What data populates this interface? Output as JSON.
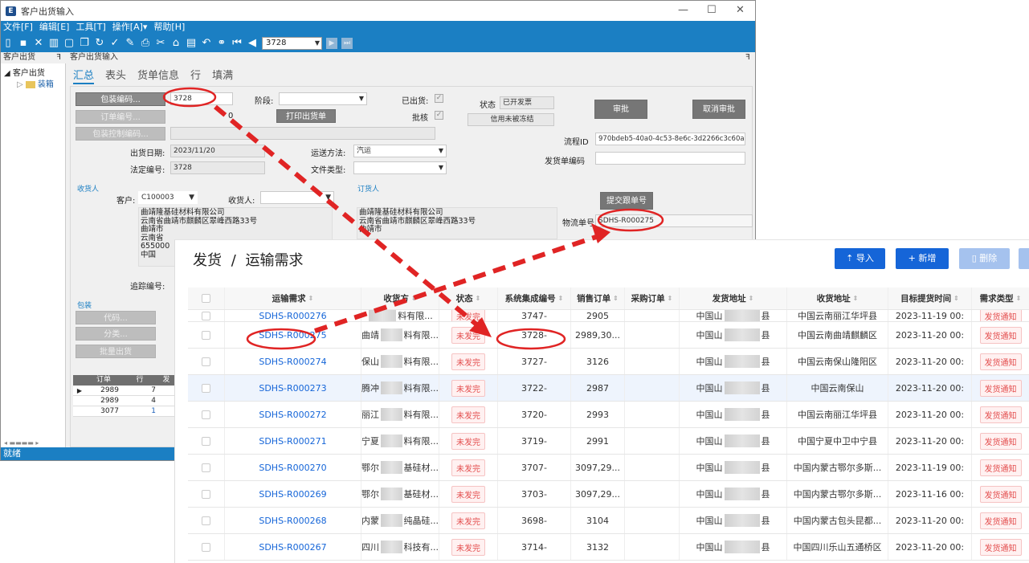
{
  "desktop": {
    "window_title": "客户出货输入",
    "menu": [
      "文件[F]",
      "编辑[E]",
      "工具[T]",
      "操作[A]▾",
      "帮助[H]"
    ],
    "toolbar_record": "3728",
    "left_pane_title": "客户出货",
    "left_pane_pin": "ꟻ",
    "right_pane_title": "客户出货输入",
    "tree": {
      "root": "客户出货",
      "child": "装箱"
    },
    "tabs": [
      "汇总",
      "表头",
      "货单信息",
      "行",
      "填满"
    ],
    "form": {
      "btn_package_code": "包装编码...",
      "package_code_value": "3728",
      "btn_order_no": "订单编号...",
      "order_no_tail": "0",
      "btn_package_ctrl": "包装控制编码...",
      "stage_label": "阶段:",
      "btn_print": "打印出货单",
      "shipped_label": "已出货:",
      "approved_label": "批核",
      "status_label": "状态",
      "status_value": "已开发票",
      "credit_value": "信用未被冻结",
      "btn_approve": "审批",
      "btn_cancel_approve": "取消审批",
      "ship_date_label": "出货日期:",
      "ship_date_value": "2023/11/20",
      "transport_label": "运送方法:",
      "transport_value": "汽运",
      "legal_no_label": "法定编号:",
      "legal_no_value": "3728",
      "file_type_label": "文件类型:",
      "flow_id_label": "流程ID",
      "flow_id_value": "970bdeb5-40a0-4c53-8e6c-3d2266c3c60a",
      "ship_order_code_label": "发货单编码",
      "consignee_section": "收货人",
      "customer_label": "客户:",
      "customer_value": "C100003",
      "receiver_label": "收货人:",
      "orderer_section": "订货人",
      "btn_submit_tracking": "提交跟单号",
      "logistics_label": "物流单号",
      "logistics_value": "SDHS-R000275",
      "consignee_address": [
        "曲靖隆基硅材料有限公司",
        "云南省曲靖市麒麟区翠峰西路33号",
        "曲靖市",
        "云南省",
        "655000",
        "中国"
      ],
      "orderer_address": [
        "曲靖隆基硅材料有限公司",
        "云南省曲靖市麒麟区翠峰西路33号",
        "曲靖市"
      ],
      "tracking_label": "追踪编号:",
      "pack_section": "包装",
      "btn_code": "代码...",
      "btn_category": "分类...",
      "btn_batch_ship": "批量出货"
    },
    "mini_grid": {
      "headers": [
        "订单",
        "行",
        "发"
      ],
      "rows": [
        [
          "2989",
          "7"
        ],
        [
          "2989",
          "4"
        ],
        [
          "3077",
          "1"
        ]
      ]
    },
    "status_bar": "就绪"
  },
  "web": {
    "breadcrumb_parent": "发货",
    "breadcrumb_sep": "/",
    "breadcrumb_current": "运输需求",
    "btn_import": "⇡ 导入",
    "btn_new": "+ 新增",
    "btn_delete": "删除",
    "columns": [
      "运输需求",
      "收货方",
      "状态",
      "系统集成编号",
      "销售订单",
      "采购订单",
      "发货地址",
      "收货地址",
      "目标提货时间",
      "需求类型"
    ],
    "rows": [
      {
        "id": "SDHS-R000276",
        "consignee": "料有限...",
        "status": "未发完",
        "sys_no": "3747-",
        "so": "2905",
        "po": "",
        "from": "中国山",
        "from2": "县",
        "to": "中国云南丽江华坪县",
        "time": "2023-11-19 00:",
        "type": "发货通知"
      },
      {
        "id": "SDHS-R000275",
        "consignee_pre": "曲靖",
        "consignee": "料有限...",
        "status": "未发完",
        "sys_no": "3728-",
        "so": "2989,30...",
        "po": "",
        "from": "中国山",
        "from2": "县",
        "to": "中国云南曲靖麒麟区",
        "time": "2023-11-20 00:",
        "type": "发货通知"
      },
      {
        "id": "SDHS-R000274",
        "consignee_pre": "保山",
        "consignee": "料有限...",
        "status": "未发完",
        "sys_no": "3727-",
        "so": "3126",
        "po": "",
        "from": "中国山",
        "from2": "县",
        "to": "中国云南保山隆阳区",
        "time": "2023-11-20 00:",
        "type": "发货通知"
      },
      {
        "id": "SDHS-R000273",
        "consignee_pre": "腾冲",
        "consignee": "料有限...",
        "status": "未发完",
        "sys_no": "3722-",
        "so": "2987",
        "po": "",
        "from": "中国山",
        "from2": "县",
        "to": "中国云南保山",
        "time": "2023-11-20 00:",
        "type": "发货通知"
      },
      {
        "id": "SDHS-R000272",
        "consignee_pre": "丽江",
        "consignee": "料有限...",
        "status": "未发完",
        "sys_no": "3720-",
        "so": "2993",
        "po": "",
        "from": "中国山",
        "from2": "县",
        "to": "中国云南丽江华坪县",
        "time": "2023-11-20 00:",
        "type": "发货通知"
      },
      {
        "id": "SDHS-R000271",
        "consignee_pre": "宁夏",
        "consignee": "料有限...",
        "status": "未发完",
        "sys_no": "3719-",
        "so": "2991",
        "po": "",
        "from": "中国山",
        "from2": "县",
        "to": "中国宁夏中卫中宁县",
        "time": "2023-11-20 00:",
        "type": "发货通知"
      },
      {
        "id": "SDHS-R000270",
        "consignee_pre": "鄂尔",
        "consignee": "基硅材...",
        "status": "未发完",
        "sys_no": "3707-",
        "so": "3097,29...",
        "po": "",
        "from": "中国山",
        "from2": "县",
        "to": "中国内蒙古鄂尔多斯...",
        "time": "2023-11-19 00:",
        "type": "发货通知"
      },
      {
        "id": "SDHS-R000269",
        "consignee_pre": "鄂尔",
        "consignee": "基硅材...",
        "status": "未发完",
        "sys_no": "3703-",
        "so": "3097,29...",
        "po": "",
        "from": "中国山",
        "from2": "县",
        "to": "中国内蒙古鄂尔多斯...",
        "time": "2023-11-16 00:",
        "type": "发货通知"
      },
      {
        "id": "SDHS-R000268",
        "consignee_pre": "内蒙",
        "consignee": "纯晶硅...",
        "status": "未发完",
        "sys_no": "3698-",
        "so": "3104",
        "po": "",
        "from": "中国山",
        "from2": "县",
        "to": "中国内蒙古包头昆都...",
        "time": "2023-11-20 00:",
        "type": "发货通知"
      },
      {
        "id": "SDHS-R000267",
        "consignee_pre": "四川",
        "consignee": "科技有...",
        "status": "未发完",
        "sys_no": "3714-",
        "so": "3132",
        "po": "",
        "from": "中国山",
        "from2": "县",
        "to": "中国四川乐山五通桥区",
        "time": "2023-11-20 00:",
        "type": "发货通知"
      }
    ]
  },
  "colors": {
    "accent": "#1b7fc3",
    "web_primary": "#1565d8",
    "annotation": "#e02424"
  }
}
